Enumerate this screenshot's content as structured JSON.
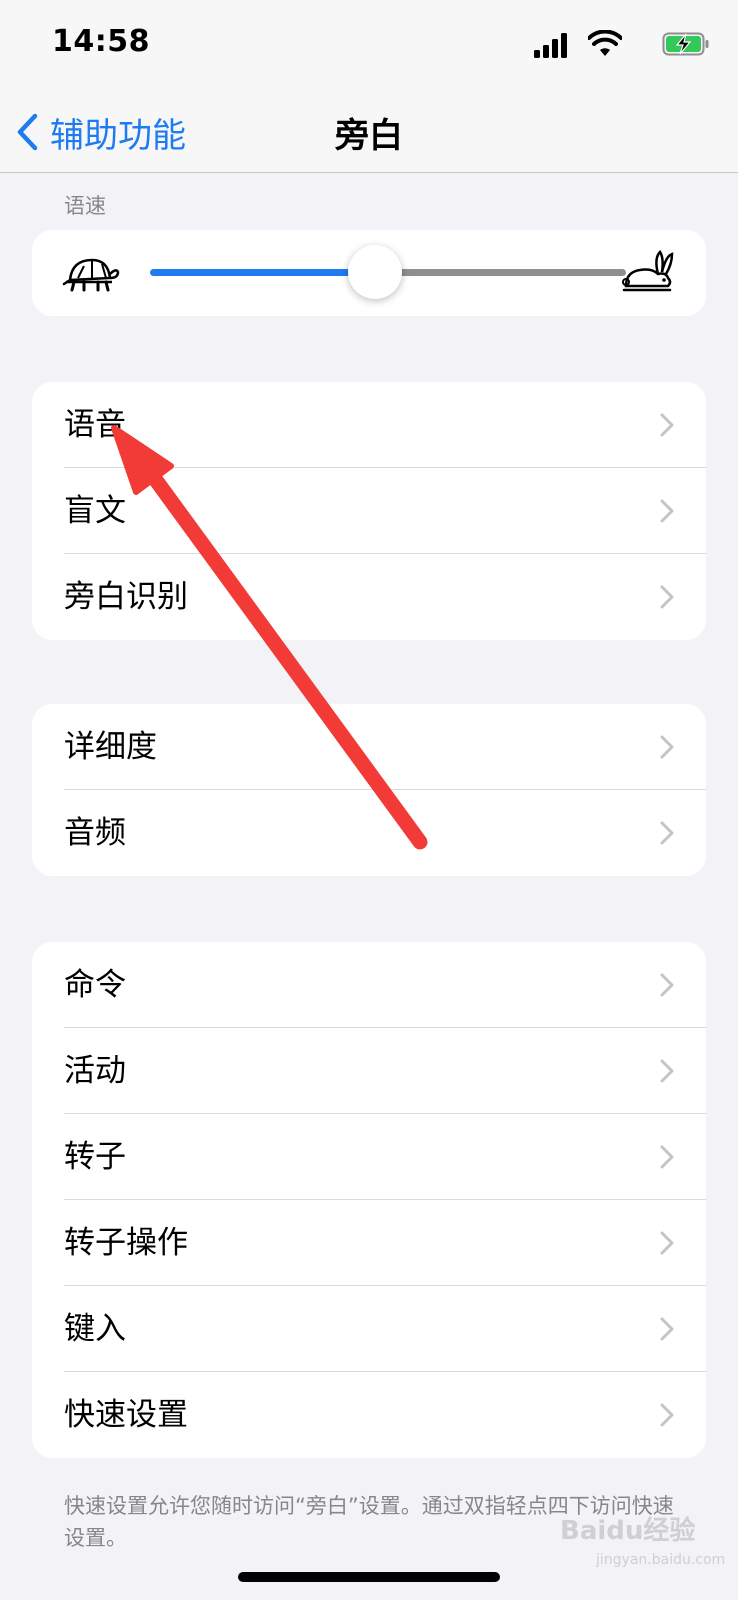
{
  "status_bar": {
    "time": "14:58",
    "battery_color": "#34c759"
  },
  "nav": {
    "back_label": "辅助功能",
    "title": "旁白",
    "accent": "#1e7bf0"
  },
  "speech_rate": {
    "header": "语速",
    "value_fraction": 0.5
  },
  "groups": [
    {
      "items": [
        {
          "label": "语音"
        },
        {
          "label": "盲文"
        },
        {
          "label": "旁白识别"
        }
      ]
    },
    {
      "items": [
        {
          "label": "详细度"
        },
        {
          "label": "音频"
        }
      ]
    },
    {
      "items": [
        {
          "label": "命令"
        },
        {
          "label": "活动"
        },
        {
          "label": "转子"
        },
        {
          "label": "转子操作"
        },
        {
          "label": "键入"
        },
        {
          "label": "快速设置"
        }
      ]
    }
  ],
  "footer_note": "快速设置允许您随时访问“旁白”设置。通过双指轻点四下访问快速设置。",
  "watermark": {
    "brand": "Baidu经验",
    "url": "jingyan.baidu.com"
  }
}
